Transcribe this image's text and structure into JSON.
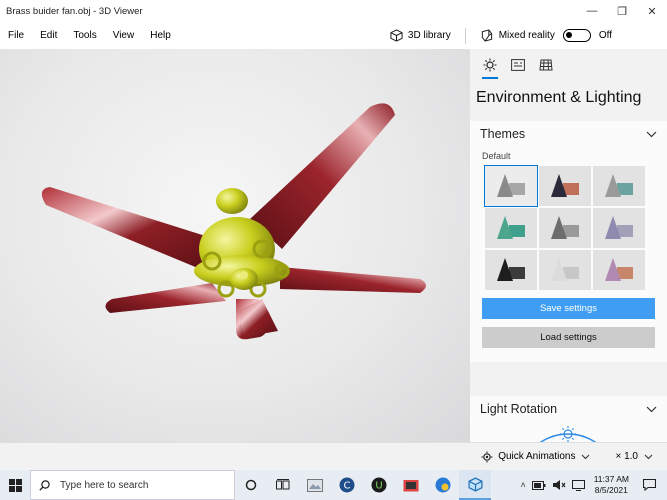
{
  "window": {
    "title": "Brass buider fan.obj - 3D Viewer",
    "minimize_glyph": "—",
    "restore_glyph": "❐",
    "close_glyph": "✕"
  },
  "menu": {
    "items": [
      "File",
      "Edit",
      "Tools",
      "View",
      "Help"
    ],
    "library_label": "3D library",
    "mixed_reality_label": "Mixed reality",
    "mixed_reality_state": "Off"
  },
  "panel": {
    "title": "Environment & Lighting",
    "themes": {
      "heading": "Themes",
      "default_label": "Default",
      "thumbnails": [
        {
          "name": "default",
          "cone": "#8a8a8a",
          "block": "#a7a7a7",
          "selected": true
        },
        {
          "name": "dusk",
          "cone": "#2a2a3a",
          "block": "#c0705a",
          "selected": false
        },
        {
          "name": "teal",
          "cone": "#9a9a9a",
          "block": "#6aa3a0",
          "selected": false
        },
        {
          "name": "mint",
          "cone": "#4da58e",
          "block": "#3fa08c",
          "selected": false
        },
        {
          "name": "steel",
          "cone": "#6d6d6d",
          "block": "#9a9a9a",
          "selected": false
        },
        {
          "name": "violet",
          "cone": "#8f8ab0",
          "block": "#a2a0b8",
          "selected": false
        },
        {
          "name": "noir",
          "cone": "#1e1e1e",
          "block": "#3b3b3b",
          "selected": false
        },
        {
          "name": "ghost",
          "cone": "#dcdcdc",
          "block": "#c7c7c7",
          "selected": false
        },
        {
          "name": "sunset",
          "cone": "#b08ab0",
          "block": "#c7866a",
          "selected": false
        }
      ]
    },
    "save_label": "Save settings",
    "load_label": "Load settings",
    "light_rotation": {
      "heading": "Light Rotation"
    }
  },
  "status": {
    "quick_animations": "Quick Animations",
    "zoom": "× 1.0"
  },
  "taskbar": {
    "search_placeholder": "Type here to search",
    "time": "11:37 AM",
    "date": "8/5/2021"
  },
  "colors": {
    "accent": "#0078d7",
    "save_button": "#3f9ef3",
    "fan_blade": "#8c1f25",
    "fan_body": "#c9cf1e"
  }
}
